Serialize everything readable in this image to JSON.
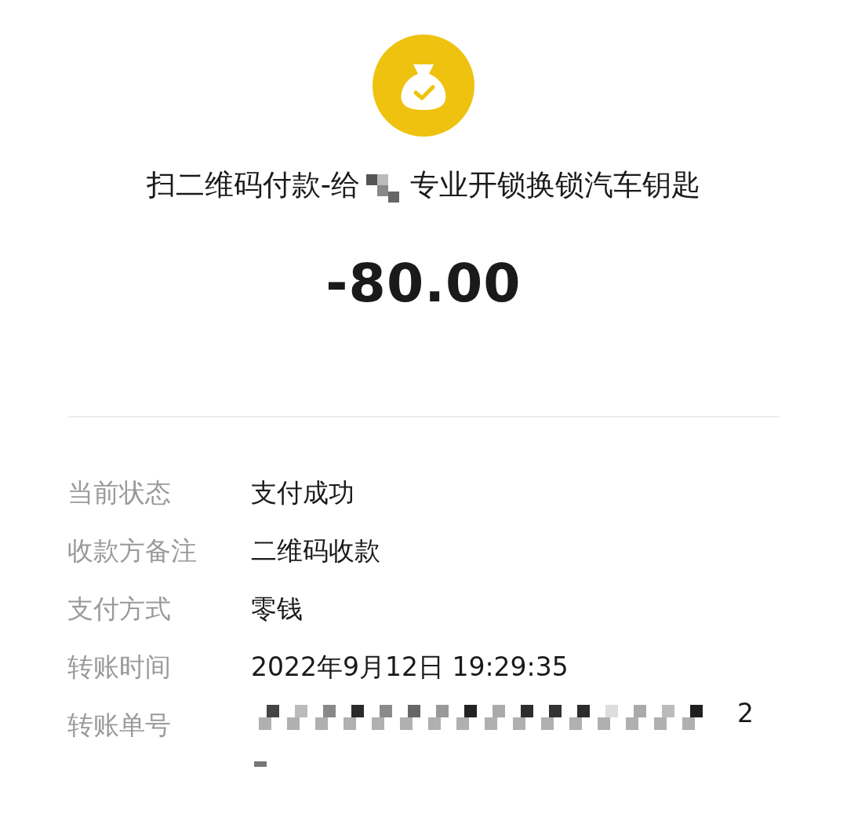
{
  "header": {
    "title_before": "扫二维码付款-给",
    "title_after": "专业开锁换锁汽车钥匙",
    "amount": "-80.00"
  },
  "details": [
    {
      "kind": "text",
      "label": "当前状态",
      "value": "支付成功"
    },
    {
      "kind": "text",
      "label": "收款方备注",
      "value": "二维码收款"
    },
    {
      "kind": "text",
      "label": "支付方式",
      "value": "零钱"
    },
    {
      "kind": "text",
      "label": "转账时间",
      "value": "2022年9月12日 19:29:35"
    },
    {
      "kind": "redacted",
      "label": "转账单号",
      "value": "2"
    }
  ]
}
